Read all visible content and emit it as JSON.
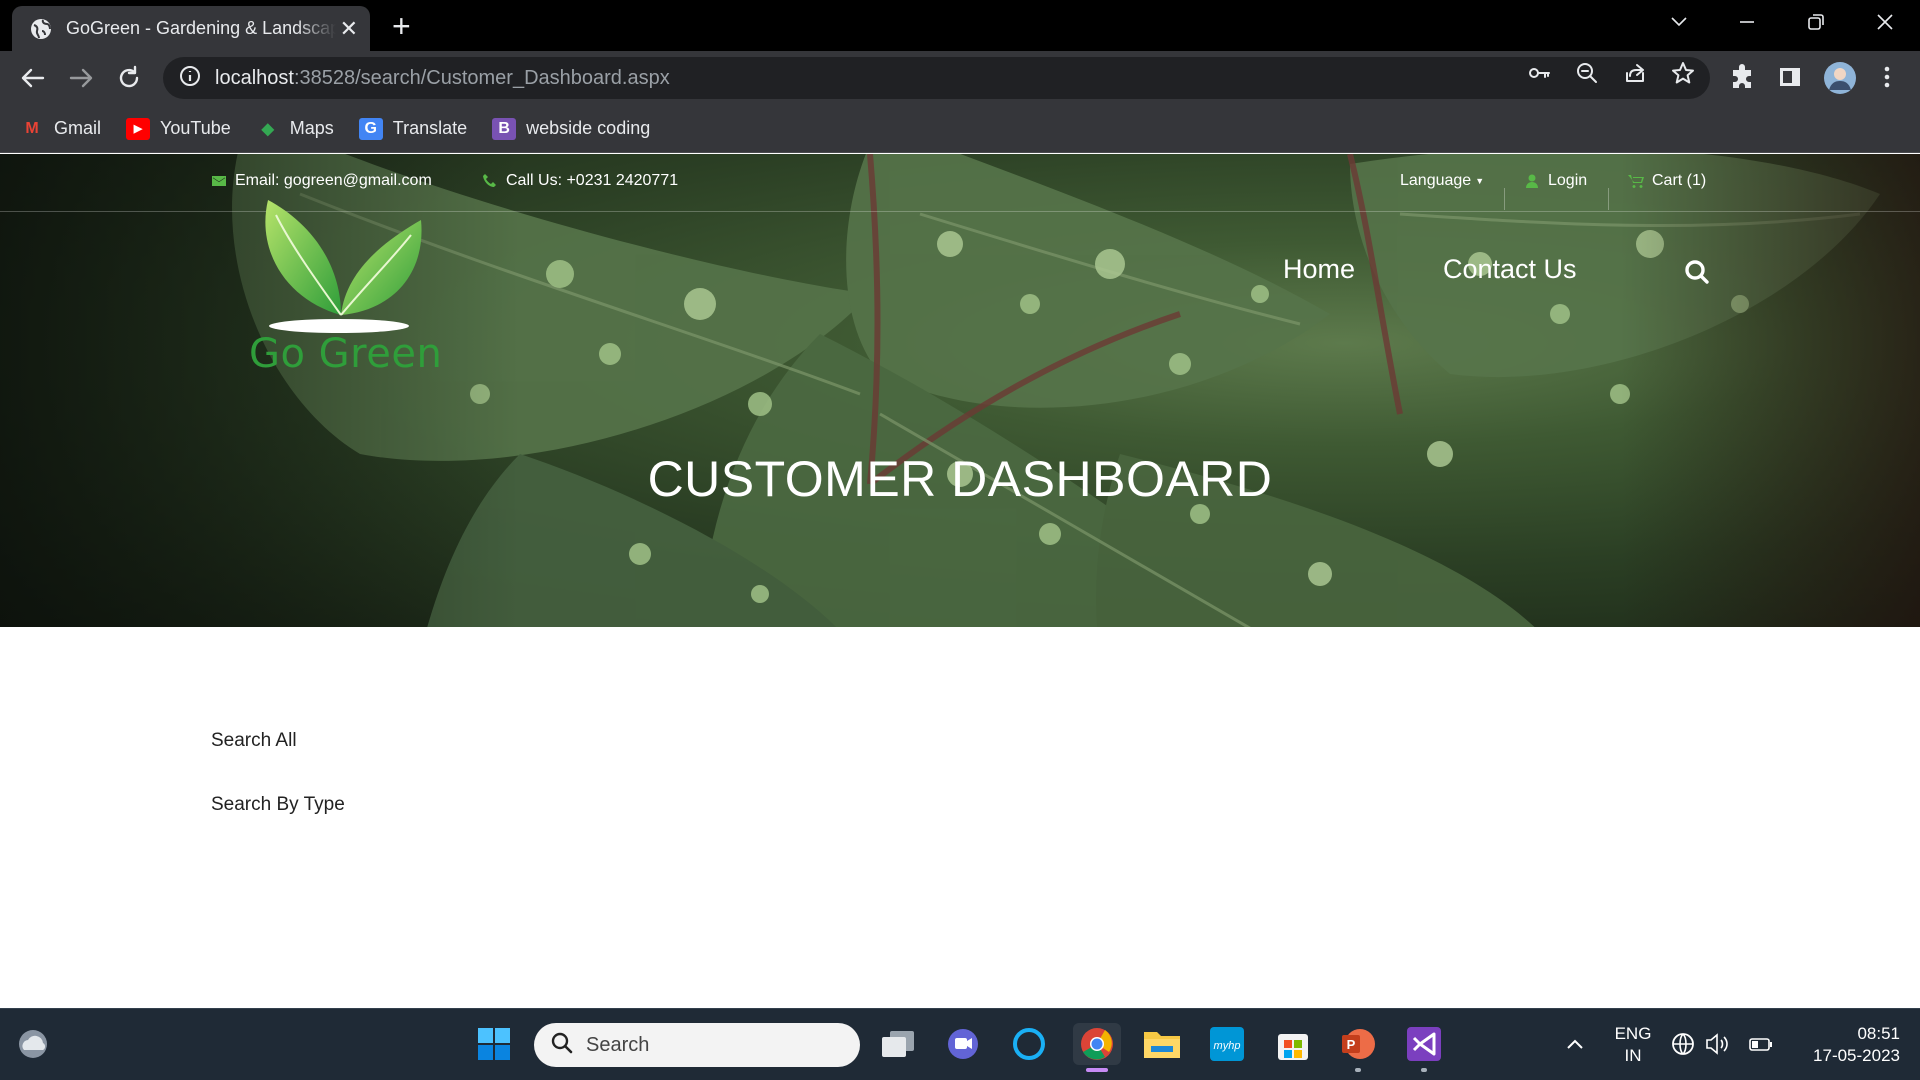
{
  "browser": {
    "tab_title": "GoGreen - Gardening & Landscaping",
    "tab_close": "✕",
    "new_tab": "+",
    "url_host": "localhost",
    "url_path": ":38528/search/Customer_Dashboard.aspx",
    "bookmarks": [
      {
        "label": "Gmail",
        "icon": "gmail-icon",
        "glyph": "M",
        "color": "#ea4335"
      },
      {
        "label": "YouTube",
        "icon": "youtube-icon",
        "glyph": "▶",
        "color": "#ff0000"
      },
      {
        "label": "Maps",
        "icon": "maps-icon",
        "glyph": "◆",
        "color": "#34a853"
      },
      {
        "label": "Translate",
        "icon": "translate-icon",
        "glyph": "G",
        "color": "#4285f4"
      },
      {
        "label": "webside coding",
        "icon": "bootstrap-icon",
        "glyph": "B",
        "color": "#7952b3"
      }
    ]
  },
  "site": {
    "email": "Email: gogreen@gmail.com",
    "phone": "Call Us: +0231 2420771",
    "language": "Language",
    "login": "Login",
    "cart": "Cart (1)",
    "logo_text": "Go Green",
    "nav": {
      "home": "Home",
      "contact": "Contact Us"
    },
    "hero_title": "CUSTOMER DASHBOARD",
    "links": {
      "search_all": "Search All",
      "search_by_type": "Search By Type"
    }
  },
  "taskbar": {
    "search_placeholder": "Search",
    "lang_top": "ENG",
    "lang_bottom": "IN",
    "time": "08:51",
    "date": "17-05-2023"
  },
  "colors": {
    "brand_green": "#2f9e3a",
    "icon_green": "#58b947"
  }
}
